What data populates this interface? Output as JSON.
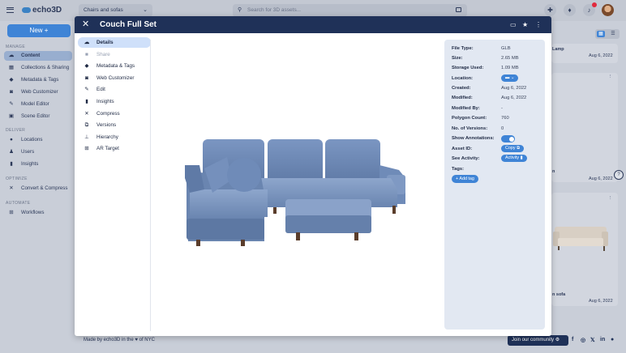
{
  "app": {
    "logo_text": "echo3D"
  },
  "header": {
    "category_value": "Chairs and sofas",
    "search_placeholder": "Search for 3D assets..."
  },
  "sidebar": {
    "new_label": "New +",
    "sections": [
      {
        "title": "MANAGE",
        "items": [
          {
            "label": "Content",
            "icon": "cloud-icon",
            "active": true
          },
          {
            "label": "Collections & Sharing",
            "icon": "grid-icon"
          },
          {
            "label": "Metadata & Tags",
            "icon": "tag-icon"
          },
          {
            "label": "Web Customizer",
            "icon": "vr-icon"
          },
          {
            "label": "Model Editor",
            "icon": "pen-icon"
          },
          {
            "label": "Scene Editor",
            "icon": "cubes-icon"
          }
        ]
      },
      {
        "title": "DELIVER",
        "items": [
          {
            "label": "Locations",
            "icon": "pin-icon"
          },
          {
            "label": "Users",
            "icon": "user-icon"
          },
          {
            "label": "Insights",
            "icon": "chart-icon"
          }
        ]
      },
      {
        "title": "OPTIMIZE",
        "items": [
          {
            "label": "Convert & Compress",
            "icon": "compress-icon"
          }
        ]
      },
      {
        "title": "AUTOMATE",
        "items": [
          {
            "label": "Workflows",
            "icon": "workflow-icon"
          }
        ]
      }
    ]
  },
  "background_cards": {
    "card1_name": "Lamp",
    "card1_date": "Aug 6, 2022",
    "card2_name": "n",
    "card2_date": "Aug 6, 2022",
    "card3_name": "n sofa",
    "card3_date": "Aug 6, 2022"
  },
  "modal": {
    "title": "Couch Full Set",
    "tabs": [
      {
        "label": "Details",
        "icon": "cloud-icon",
        "state": "active"
      },
      {
        "label": "Share",
        "icon": "lock-icon",
        "state": "disabled"
      },
      {
        "label": "Metadata & Tags",
        "icon": "tag-icon",
        "state": "normal"
      },
      {
        "label": "Web Customizer",
        "icon": "vr-icon",
        "state": "normal"
      },
      {
        "label": "Edit",
        "icon": "pen-icon",
        "state": "normal"
      },
      {
        "label": "Insights",
        "icon": "chart-icon",
        "state": "normal"
      },
      {
        "label": "Compress",
        "icon": "compress-icon",
        "state": "normal"
      },
      {
        "label": "Versions",
        "icon": "versions-icon",
        "state": "normal"
      },
      {
        "label": "Hierarchy",
        "icon": "hierarchy-icon",
        "state": "normal"
      },
      {
        "label": "AR Target",
        "icon": "target-icon",
        "state": "normal"
      }
    ],
    "details": {
      "file_type": {
        "label": "File Type:",
        "value": "GLB"
      },
      "size": {
        "label": "Size:",
        "value": "2.65 MB"
      },
      "storage_used": {
        "label": "Storage Used:",
        "value": "1.09 MB"
      },
      "location": {
        "label": "Location:"
      },
      "created": {
        "label": "Created:",
        "value": "Aug 6, 2022"
      },
      "modified": {
        "label": "Modified:",
        "value": "Aug 6, 2022"
      },
      "modified_by": {
        "label": "Modified By:",
        "value": "-"
      },
      "polygon_count": {
        "label": "Polygon Count:",
        "value": "760"
      },
      "versions": {
        "label": "No. of Versions:",
        "value": "0"
      },
      "show_annotations": {
        "label": "Show Annotations:",
        "enabled": true
      },
      "asset_id": {
        "label": "Asset ID:",
        "button": "Copy"
      },
      "see_activity": {
        "label": "See Activity:",
        "button": "Activity"
      },
      "tags": {
        "label": "Tags:",
        "add_button": "+ Add tag"
      }
    }
  },
  "footer": {
    "made_by_1": "Made by echo3D in the",
    "made_by_2": "of NYC",
    "community": "Join our community"
  },
  "colors": {
    "primary": "#3f84d6",
    "navy": "#1f3158",
    "sofa": "#6f8bb8"
  }
}
